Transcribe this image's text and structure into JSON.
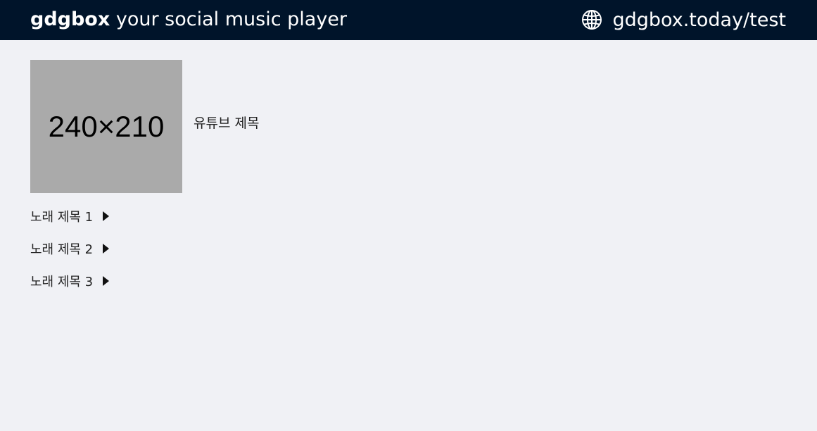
{
  "header": {
    "brand_name": "gdgbox",
    "tagline": "your social music player",
    "room_url": "gdgbox.today/test",
    "room_icon": "globe-icon",
    "background_color": "#00142a"
  },
  "video": {
    "thumbnail_text": "240×210",
    "title": "유튜브 제목"
  },
  "songs": [
    {
      "title": "노래 제목 1",
      "icon": "play-icon"
    },
    {
      "title": "노래 제목 2",
      "icon": "play-icon"
    },
    {
      "title": "노래 제목 3",
      "icon": "play-icon"
    }
  ]
}
